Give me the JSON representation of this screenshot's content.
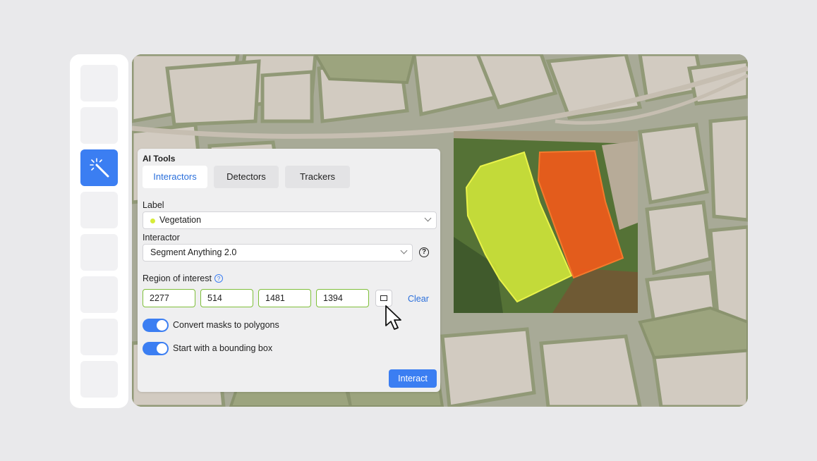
{
  "sidebar": {
    "tools": [
      {
        "icon": "blank-tool",
        "active": false
      },
      {
        "icon": "blank-tool",
        "active": false
      },
      {
        "icon": "magic-wand-icon",
        "active": true
      },
      {
        "icon": "blank-tool",
        "active": false
      },
      {
        "icon": "blank-tool",
        "active": false
      },
      {
        "icon": "blank-tool",
        "active": false
      },
      {
        "icon": "blank-tool",
        "active": false
      },
      {
        "icon": "blank-tool",
        "active": false
      }
    ]
  },
  "panel": {
    "title": "AI Tools",
    "tabs": [
      {
        "label": "Interactors",
        "active": true
      },
      {
        "label": "Detectors",
        "active": false
      },
      {
        "label": "Trackers",
        "active": false
      }
    ],
    "label_field": {
      "label": "Label",
      "value": "Vegetation",
      "dot_color": "#d7ec3a"
    },
    "interactor_field": {
      "label": "Interactor",
      "value": "Segment Anything 2.0",
      "help_icon": "?"
    },
    "roi": {
      "label": "Region of interest",
      "help_icon": "?",
      "values": [
        "2277",
        "514",
        "1481",
        "1394"
      ],
      "rect_icon": "rectangle-icon",
      "clear_label": "Clear"
    },
    "toggles": [
      {
        "label": "Convert masks to polygons",
        "on": true
      },
      {
        "label": "Start with a bounding box",
        "on": true
      }
    ],
    "interact_label": "Interact"
  },
  "colors": {
    "accent": "#3b7ef2",
    "link": "#2a6fdb",
    "input_border_valid": "#7fbf3a",
    "mask_vegetation": "#d7ec3a",
    "mask_second": "#f05a1a"
  }
}
